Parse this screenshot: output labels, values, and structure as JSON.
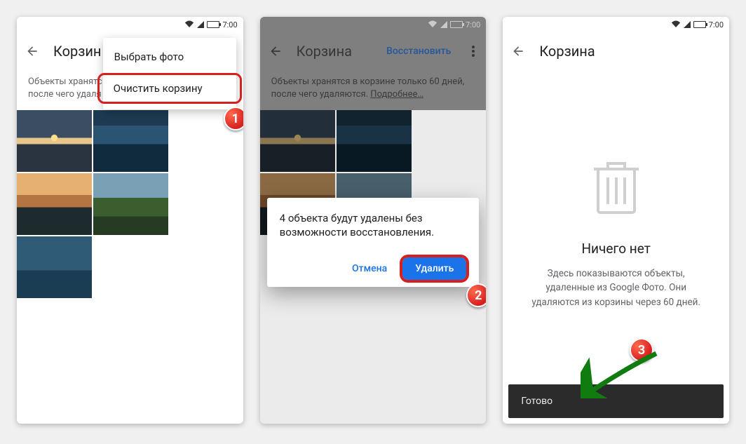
{
  "status_time": "7:00",
  "screen1": {
    "title": "Корзин",
    "info_visible": "Объекты хранятс\nпосле чего удаля",
    "menu": {
      "select": "Выбрать фото",
      "empty": "Очистить корзину"
    },
    "thumbs": [
      "t-sunset1",
      "t-lake",
      "t-sunset2",
      "t-green",
      "t-boats"
    ],
    "badge": "1"
  },
  "screen2": {
    "title": "Корзина",
    "restore": "Восстановить",
    "info": "Объекты хранятся в корзине только 60 дней, после чего удаляются.",
    "info_more": "Подробнее…",
    "thumbs": [
      "t-sunset1",
      "t-lake",
      "t-sunset2",
      "t-green"
    ],
    "dialog_text": "4 объекта будут удалены без возможности восстановления.",
    "cancel": "Отмена",
    "delete": "Удалить",
    "badge": "2"
  },
  "screen3": {
    "title": "Корзина",
    "empty_title": "Ничего нет",
    "empty_sub": "Здесь показываются объекты, удаленные из Google Фото. Они удаляются из корзины через 60 дней.",
    "snackbar": "Готово",
    "badge": "3"
  }
}
